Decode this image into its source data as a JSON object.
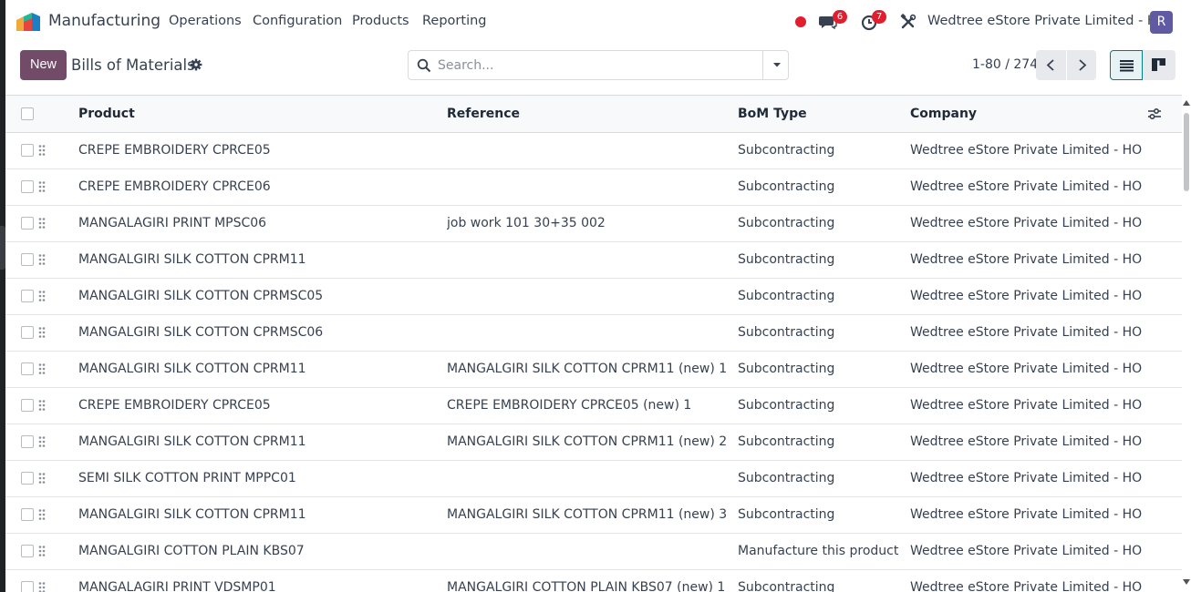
{
  "navbar": {
    "app_name": "Manufacturing",
    "menus": [
      "Operations",
      "Configuration",
      "Products",
      "Reporting"
    ],
    "messages_count": "6",
    "activities_count": "7",
    "company": "Wedtree eStore Private Limited - HO",
    "avatar_letter": "R",
    "colors": {
      "record_dot": "#e11d2e",
      "badge": "#e11d2e",
      "avatar": "#5f5aa2"
    },
    "icons": [
      "manufacturing-logo",
      "record-dot",
      "chat-icon",
      "clock-icon",
      "tools-icon",
      "avatar"
    ]
  },
  "control_panel": {
    "new_label": "New",
    "title": "Bills of Materials",
    "search_placeholder": "Search...",
    "pager_value": "1-80 / 274",
    "colors": {
      "new_button": "#714b67",
      "active_view": "#017e84"
    }
  },
  "table": {
    "headers": {
      "product": "Product",
      "reference": "Reference",
      "bom_type": "BoM Type",
      "company": "Company"
    },
    "rows": [
      {
        "product": "CREPE EMBROIDERY CPRCE05",
        "reference": "",
        "bom_type": "Subcontracting",
        "company": "Wedtree eStore Private Limited - HO"
      },
      {
        "product": "CREPE EMBROIDERY CPRCE06",
        "reference": "",
        "bom_type": "Subcontracting",
        "company": "Wedtree eStore Private Limited - HO"
      },
      {
        "product": "MANGALAGIRI PRINT MPSC06",
        "reference": "job work 101 30+35 002",
        "bom_type": "Subcontracting",
        "company": "Wedtree eStore Private Limited - HO"
      },
      {
        "product": "MANGALGIRI SILK COTTON CPRM11",
        "reference": "",
        "bom_type": "Subcontracting",
        "company": "Wedtree eStore Private Limited - HO"
      },
      {
        "product": "MANGALGIRI SILK COTTON CPRMSC05",
        "reference": "",
        "bom_type": "Subcontracting",
        "company": "Wedtree eStore Private Limited - HO"
      },
      {
        "product": "MANGALGIRI SILK COTTON CPRMSC06",
        "reference": "",
        "bom_type": "Subcontracting",
        "company": "Wedtree eStore Private Limited - HO"
      },
      {
        "product": "MANGALGIRI SILK COTTON CPRM11",
        "reference": "MANGALGIRI SILK COTTON CPRM11 (new) 1",
        "bom_type": "Subcontracting",
        "company": "Wedtree eStore Private Limited - HO"
      },
      {
        "product": "CREPE EMBROIDERY CPRCE05",
        "reference": "CREPE EMBROIDERY CPRCE05 (new) 1",
        "bom_type": "Subcontracting",
        "company": "Wedtree eStore Private Limited - HO"
      },
      {
        "product": "MANGALGIRI SILK COTTON CPRM11",
        "reference": "MANGALGIRI SILK COTTON CPRM11 (new) 2",
        "bom_type": "Subcontracting",
        "company": "Wedtree eStore Private Limited - HO"
      },
      {
        "product": "SEMI SILK COTTON PRINT MPPC01",
        "reference": "",
        "bom_type": "Subcontracting",
        "company": "Wedtree eStore Private Limited - HO"
      },
      {
        "product": "MANGALGIRI SILK COTTON CPRM11",
        "reference": "MANGALGIRI SILK COTTON CPRM11 (new) 3",
        "bom_type": "Subcontracting",
        "company": "Wedtree eStore Private Limited - HO"
      },
      {
        "product": "MANGALGIRI COTTON PLAIN KBS07",
        "reference": "",
        "bom_type": "Manufacture this product",
        "company": "Wedtree eStore Private Limited - HO"
      },
      {
        "product": "MANGALAGIRI PRINT VDSMP01",
        "reference": "MANGALGIRI COTTON PLAIN KBS07 (new) 1",
        "bom_type": "Subcontracting",
        "company": "Wedtree eStore Private Limited - HO"
      }
    ]
  }
}
